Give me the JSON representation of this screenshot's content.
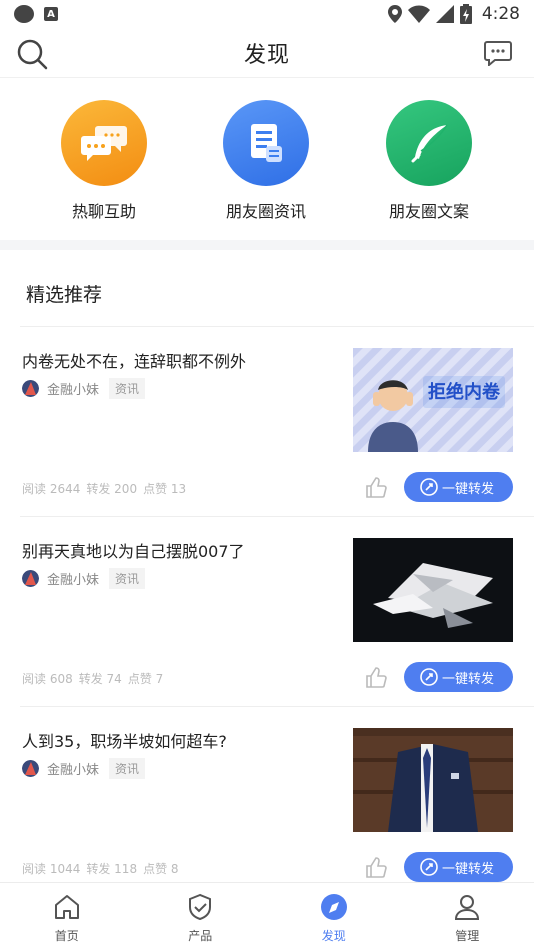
{
  "status_bar": {
    "time": "4:28",
    "notif_letter": "A"
  },
  "header": {
    "title": "发现"
  },
  "quick_actions": [
    {
      "label": "热聊互助",
      "icon": "chat-bubbles-icon",
      "color": "#f7a21c"
    },
    {
      "label": "朋友圈资讯",
      "icon": "document-icon",
      "color": "#3d7ff0"
    },
    {
      "label": "朋友圈文案",
      "icon": "feather-icon",
      "color": "#20b36b"
    }
  ],
  "section": {
    "title": "精选推荐"
  },
  "articles": [
    {
      "title": "内卷无处不在，连辞职都不例外",
      "author": "金融小妹",
      "tag": "资讯",
      "read": "阅读 2644",
      "forward": "转发 200",
      "likes": "点赞 13",
      "share_label": "一键转发",
      "thumb_text": "拒绝内卷"
    },
    {
      "title": "别再天真地以为自己摆脱007了",
      "author": "金融小妹",
      "tag": "资讯",
      "read": "阅读 608",
      "forward": "转发 74",
      "likes": "点赞 7",
      "share_label": "一键转发"
    },
    {
      "title": "人到35，职场半坡如何超车?",
      "author": "金融小妹",
      "tag": "资讯",
      "read": "阅读 1044",
      "forward": "转发 118",
      "likes": "点赞 8",
      "share_label": "一键转发"
    }
  ],
  "tabs": [
    {
      "label": "首页",
      "icon": "home-icon"
    },
    {
      "label": "产品",
      "icon": "shield-check-icon"
    },
    {
      "label": "发现",
      "icon": "compass-icon",
      "active": true
    },
    {
      "label": "管理",
      "icon": "user-icon"
    }
  ],
  "colors": {
    "accent": "#4f7ef0",
    "divider": "#f4f5f7"
  }
}
